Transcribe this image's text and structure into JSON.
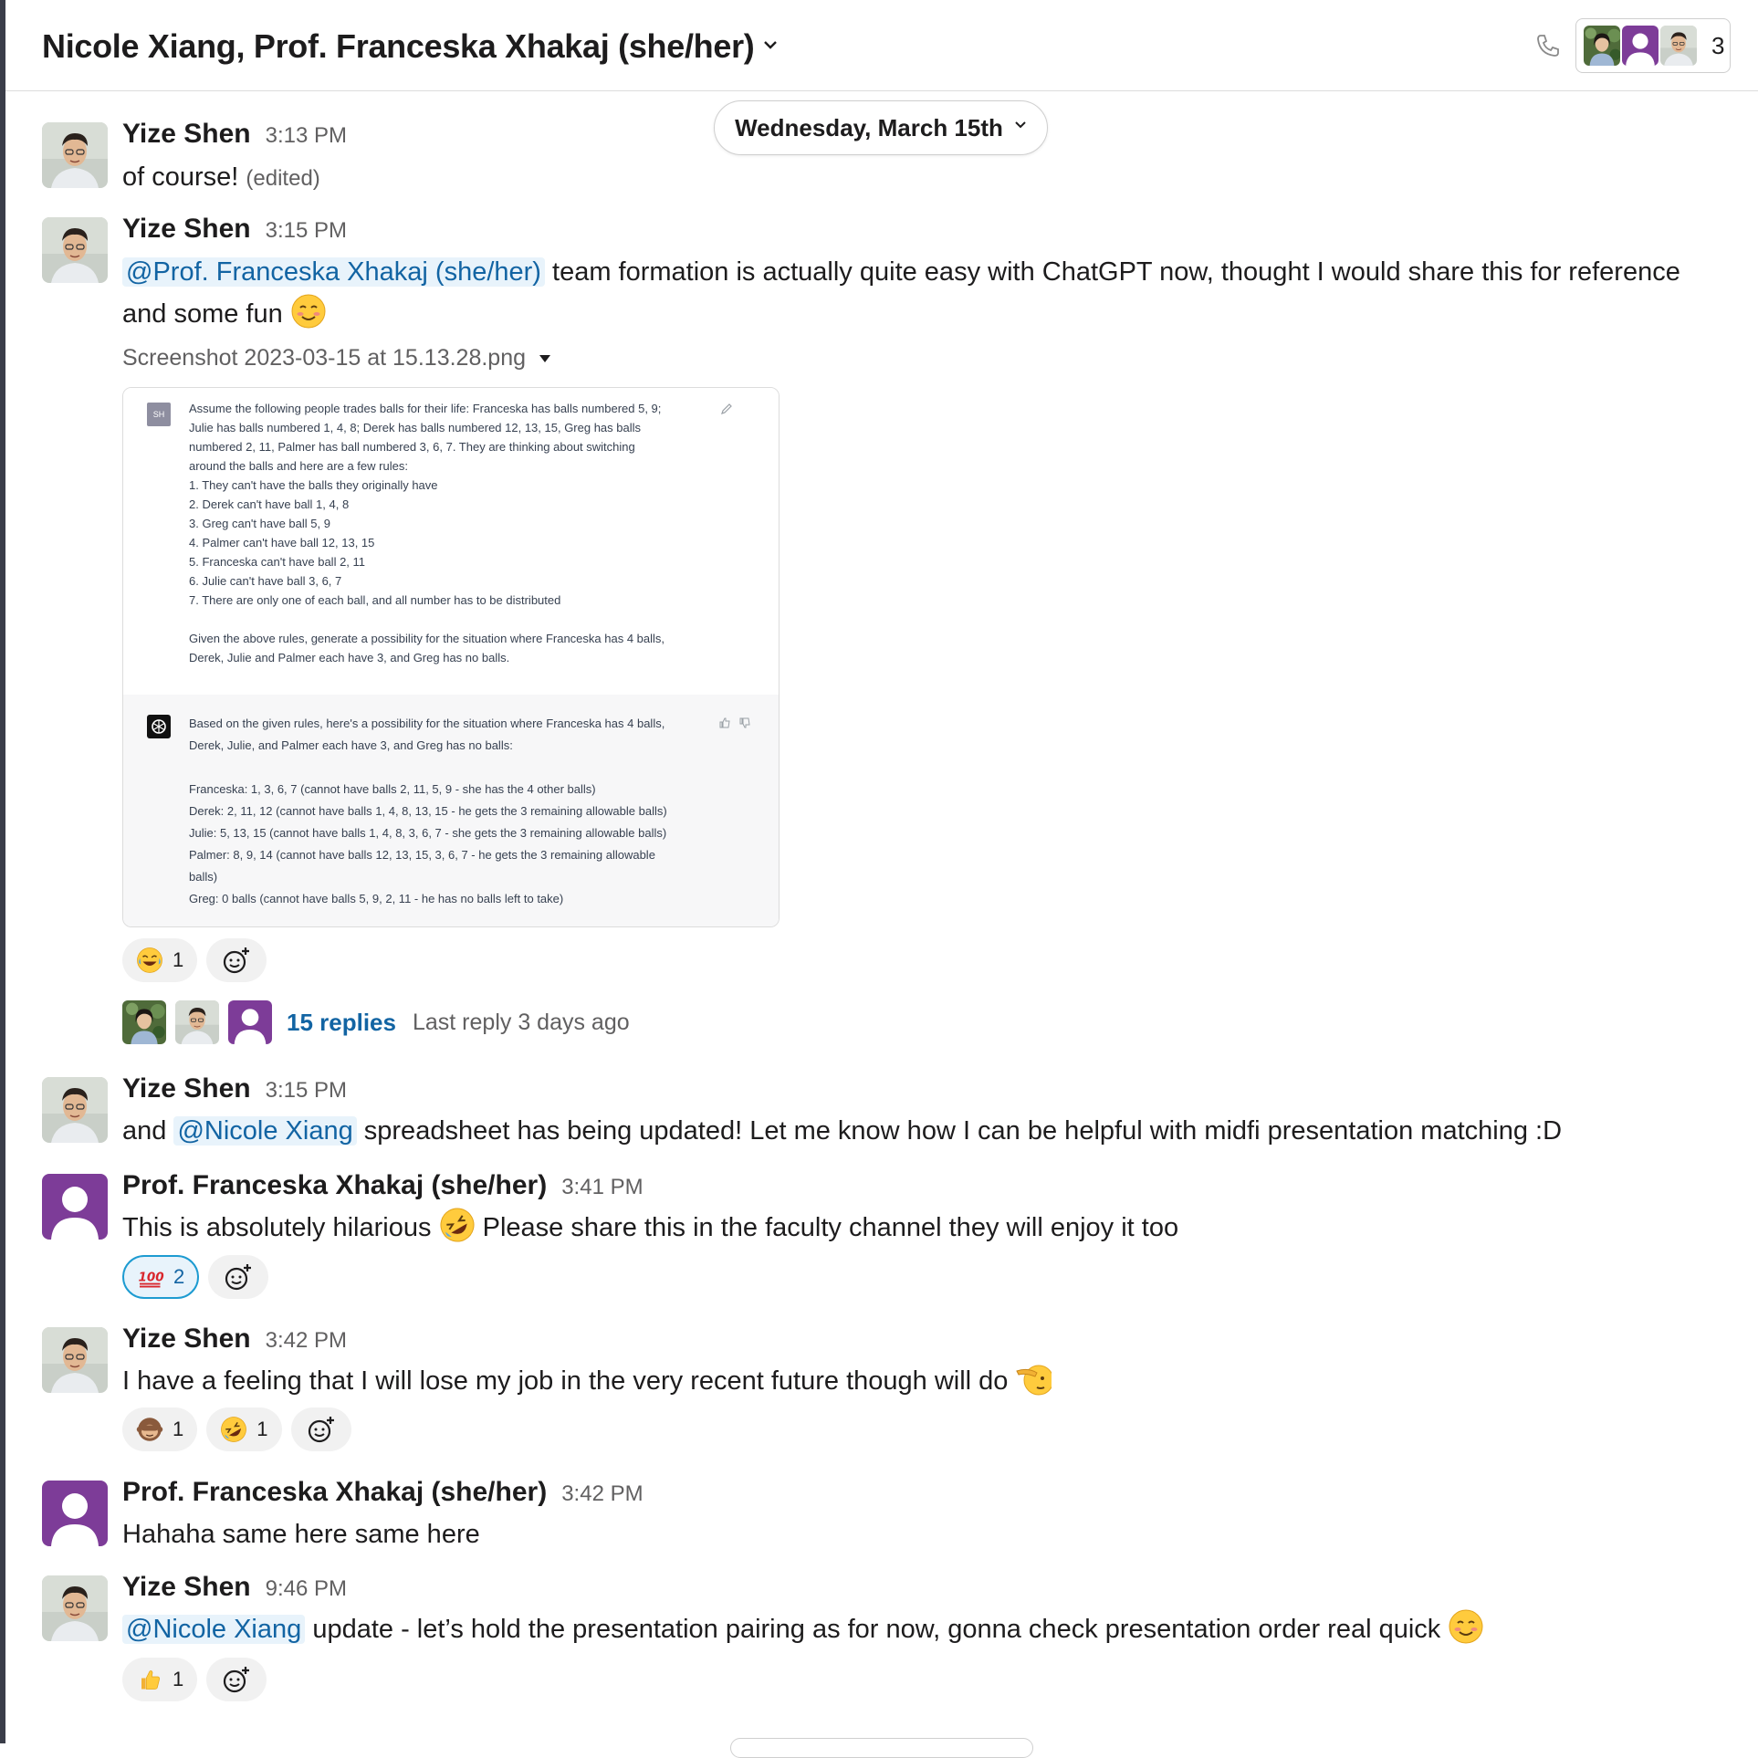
{
  "header": {
    "title": "Nicole Xiang, Prof. Franceska Xhakaj (she/her)",
    "member_count": "3"
  },
  "date_divider": "Wednesday, March 15th",
  "messages": [
    {
      "sender": "Yize Shen",
      "time": "3:13 PM",
      "text": "of course!",
      "edited": "(edited)"
    },
    {
      "sender": "Yize Shen",
      "time": "3:15 PM",
      "mention": "@Prof. Franceska Xhakaj (she/her)",
      "text_line1": " team formation is actually quite easy with ChatGPT now, thought I would share this for reference",
      "text_line2": "and some fun",
      "file_name": "Screenshot 2023-03-15 at 15.13.28.png",
      "attachment": {
        "user_badge": "SH",
        "prompt_lines": [
          "Assume the following people trades balls for their life: Franceska has balls numbered 5, 9;",
          "Julie has balls numbered 1, 4, 8; Derek has balls numbered 12, 13, 15, Greg has balls",
          "numbered 2, 11, Palmer has ball numbered 3, 6, 7. They are thinking about switching",
          "around the balls and here are a few rules:",
          "1. They can't have the balls they originally have",
          "2. Derek can't have ball 1, 4, 8",
          "3. Greg can't have ball 5, 9",
          "4. Palmer can't have ball 12, 13, 15",
          "5. Franceska can't have ball 2, 11",
          "6. Julie can't have ball 3, 6, 7",
          "7. There are only one of each ball, and all number has to be distributed",
          "",
          "Given the above rules, generate a possibility for the situation where Franceska has 4 balls,",
          "Derek, Julie and Palmer each have 3, and Greg has no balls."
        ],
        "response_lines": [
          "Based on the given rules, here's a possibility for the situation where Franceska has 4 balls,",
          "Derek, Julie, and Palmer each have 3, and Greg has no balls:",
          "",
          "Franceska: 1, 3, 6, 7 (cannot have balls 2, 11, 5, 9 - she has the 4 other balls)",
          "Derek: 2, 11, 12 (cannot have balls 1, 4, 8, 13, 15 - he gets the 3 remaining allowable balls)",
          "Julie: 5, 13, 15 (cannot have balls 1, 4, 8, 3, 6, 7 - she gets the 3 remaining allowable balls)",
          "Palmer: 8, 9, 14 (cannot have balls 12, 13, 15, 3, 6, 7 - he gets the 3 remaining allowable",
          "balls)",
          "Greg: 0 balls (cannot have balls 5, 9, 2, 11 - he has no balls left to take)"
        ]
      },
      "reactions": [
        {
          "emoji": "joy",
          "count": "1"
        }
      ],
      "thread": {
        "replies": "15 replies",
        "last_reply": "Last reply 3 days ago"
      }
    },
    {
      "sender": "Yize Shen",
      "time": "3:15 PM",
      "text_before": "and ",
      "mention": "@Nicole Xiang",
      "text_after": " spreadsheet has being updated! Let me know how I can be helpful with midfi presentation matching :D"
    },
    {
      "sender": "Prof. Franceska Xhakaj (she/her)",
      "time": "3:41 PM",
      "text_before": "This is absolutely hilarious ",
      "text_after": " Please share this in the faculty channel they will enjoy it too",
      "reactions": [
        {
          "emoji": "100",
          "count": "2"
        }
      ]
    },
    {
      "sender": "Yize Shen",
      "time": "3:42 PM",
      "text": "I have a feeling that I will lose my job in the very recent future though will do",
      "reactions": [
        {
          "emoji": "see-no-evil-monkey",
          "count": "1"
        },
        {
          "emoji": "rofl",
          "count": "1"
        }
      ]
    },
    {
      "sender": "Prof. Franceska Xhakaj (she/her)",
      "time": "3:42 PM",
      "text": "Hahaha same here same here"
    },
    {
      "sender": "Yize Shen",
      "time": "9:46 PM",
      "mention": "@Nicole Xiang",
      "text_after": " update - let’s hold the presentation pairing as for now, gonna check presentation order real quick",
      "reactions": [
        {
          "emoji": "thumbsup",
          "count": "1"
        }
      ]
    }
  ],
  "icons": {
    "phone": "phone-icon",
    "add_reaction": "add-reaction-icon",
    "dropdown": "chevron-down-icon"
  },
  "colors": {
    "mention_bg": "#e8f3fb",
    "link": "#1264a3",
    "purple_avatar": "#7d3c98",
    "active_reaction_border": "#1d9bd1"
  }
}
